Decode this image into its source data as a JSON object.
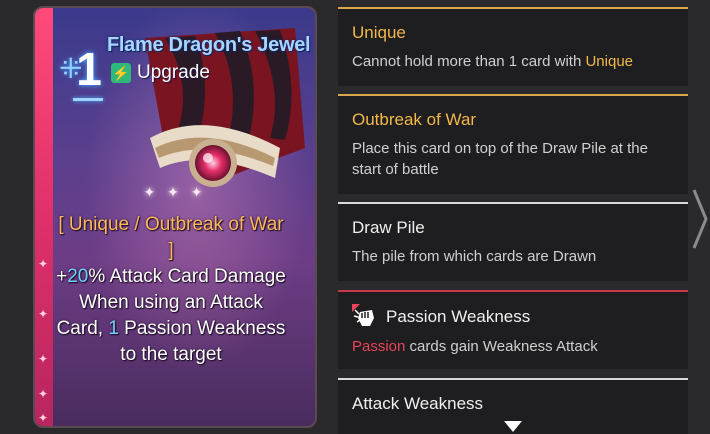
{
  "card": {
    "cost": "1",
    "title": "Flame Dragon's Jewel",
    "type": "Upgrade",
    "type_icon": "lightning-bolt-icon",
    "ornament": "✦ ✦ ✦",
    "text": {
      "tags": "[ Unique / Outbreak of War ]",
      "line1_prefix": "+",
      "line1_value": "20",
      "line1_suffix": "% Attack Card Damage",
      "line2_prefix": "When using an Attack Card, ",
      "line2_value": "1",
      "line2_suffix": " Passion Weakness to the target"
    },
    "colors": {
      "stripe": "#e0306a",
      "title": "#a9d4ff",
      "tag": "#ffb85a",
      "highlight": "#6ed2ff"
    }
  },
  "keywords": [
    {
      "title": "Unique",
      "desc_prefix": "Cannot hold more than 1 card with ",
      "desc_keyword": "Unique",
      "accent": "#f2b84a"
    },
    {
      "title": "Outbreak of War",
      "desc": "Place this card on top of the Draw Pile at the start of battle",
      "accent": "#f2b84a"
    },
    {
      "title": "Draw Pile",
      "desc": "The pile from which cards are Drawn",
      "accent": "#d8d8d8"
    },
    {
      "title": "Passion Weakness",
      "icon": "fist-icon",
      "desc_keyword": "Passion",
      "desc_suffix": " cards gain Weakness Attack",
      "accent": "#c8374a"
    },
    {
      "title": "Attack Weakness",
      "accent": "#d8d8d8"
    }
  ],
  "navigation": {
    "next_icon": "chevron-right-icon",
    "more_icon": "chevron-down-icon"
  }
}
